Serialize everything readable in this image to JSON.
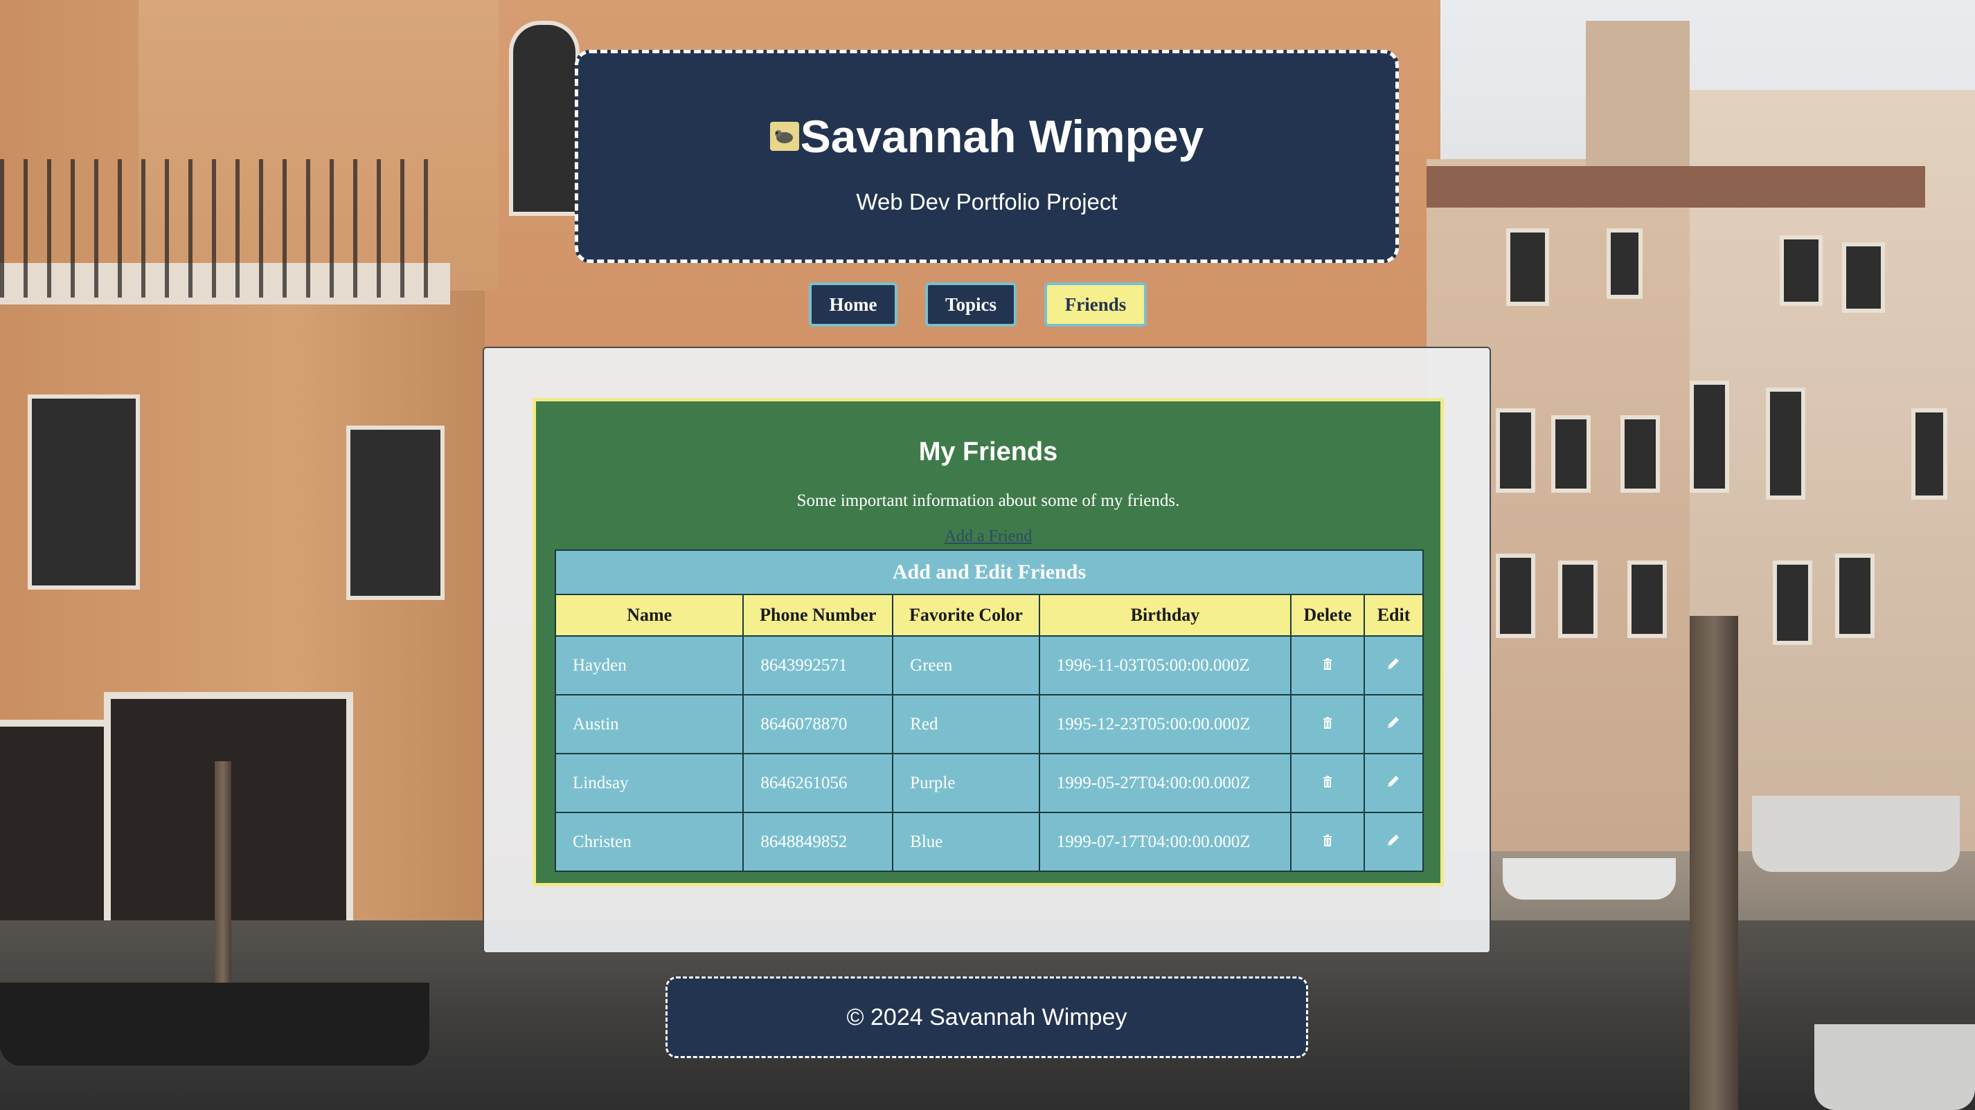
{
  "header": {
    "icon": "picture-icon",
    "title": "Savannah Wimpey",
    "subtitle": "Web Dev Portfolio Project"
  },
  "nav": {
    "items": [
      {
        "label": "Home"
      },
      {
        "label": "Topics"
      },
      {
        "label": "Friends",
        "active": true
      }
    ]
  },
  "main": {
    "title": "My Friends",
    "description": "Some important information about some of my friends.",
    "add_link": "Add a Friend",
    "table": {
      "caption": "Add and Edit Friends",
      "columns": [
        "Name",
        "Phone Number",
        "Favorite Color",
        "Birthday",
        "Delete",
        "Edit"
      ],
      "rows": [
        {
          "name": "Hayden",
          "phone": "8643992571",
          "color": "Green",
          "birthday": "1996-11-03T05:00:00.000Z"
        },
        {
          "name": "Austin",
          "phone": "8646078870",
          "color": "Red",
          "birthday": "1995-12-23T05:00:00.000Z"
        },
        {
          "name": "Lindsay",
          "phone": "8646261056",
          "color": "Purple",
          "birthday": "1999-05-27T04:00:00.000Z"
        },
        {
          "name": "Christen",
          "phone": "8648849852",
          "color": "Blue",
          "birthday": "1999-07-17T04:00:00.000Z"
        }
      ],
      "row_icons": {
        "delete": "trash-icon",
        "edit": "pencil-icon"
      }
    }
  },
  "footer": {
    "text": "© 2024 Savannah Wimpey"
  },
  "colors": {
    "navy": "#233450",
    "yellow": "#f5ef8e",
    "teal": "#7bbfcf",
    "green": "#3f7a4a"
  }
}
